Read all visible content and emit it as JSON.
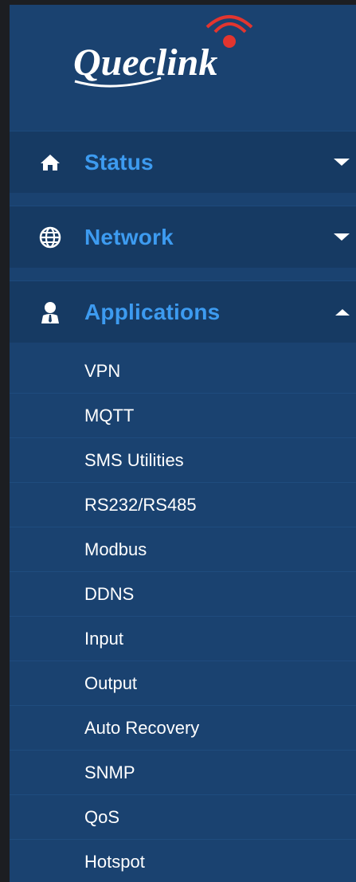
{
  "brand": {
    "logo_text": "Queclink"
  },
  "menu": {
    "status": {
      "label": "Status",
      "icon": "home-icon",
      "caret": "down"
    },
    "network": {
      "label": "Network",
      "icon": "globe-icon",
      "caret": "down"
    },
    "applications": {
      "label": "Applications",
      "icon": "user-icon",
      "caret": "up"
    }
  },
  "applications_items": [
    "VPN",
    "MQTT",
    "SMS Utilities",
    "RS232/RS485",
    "Modbus",
    "DDNS",
    "Input",
    "Output",
    "Auto Recovery",
    "SNMP",
    "QoS",
    "Hotspot"
  ],
  "colors": {
    "sidebar_bg": "#1a4270",
    "section_bg": "#163a63",
    "accent_text": "#3d9bf0",
    "item_text": "#ffffff",
    "logo_signal": "#e2352f"
  }
}
